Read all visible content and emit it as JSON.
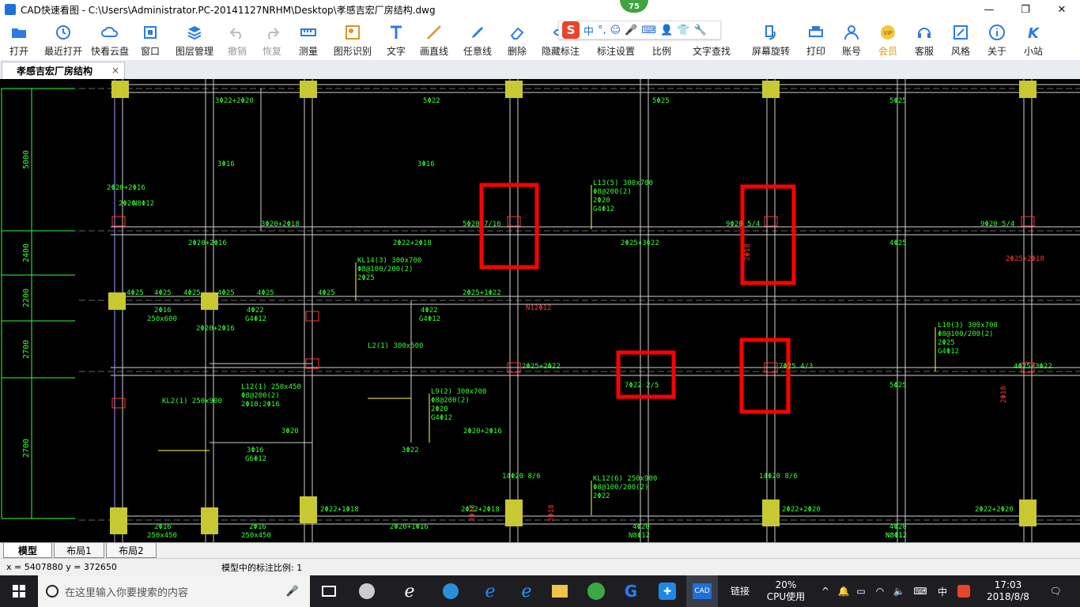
{
  "window": {
    "title": "CAD快速看图 - C:\\Users\\Administrator.PC-20141127NRHM\\Desktop\\孝感吉宏厂房结构.dwg",
    "badge": "75",
    "controls": {
      "minimize": "—",
      "maximize": "❐",
      "close": "✕"
    }
  },
  "toolbar": [
    {
      "id": "open",
      "label": "打开",
      "icon": "folder-icon"
    },
    {
      "id": "recent",
      "label": "最近打开",
      "icon": "history-icon"
    },
    {
      "id": "cloud",
      "label": "快看云盘",
      "icon": "cloud-icon"
    },
    {
      "id": "window",
      "label": "窗口",
      "icon": "window-icon"
    },
    {
      "id": "layers",
      "label": "图层管理",
      "icon": "layers-icon"
    },
    {
      "id": "undo",
      "label": "撤销",
      "icon": "undo-icon",
      "disabled": true
    },
    {
      "id": "redo",
      "label": "恢复",
      "icon": "redo-icon",
      "disabled": true
    },
    {
      "id": "measure",
      "label": "测量",
      "icon": "ruler-icon"
    },
    {
      "id": "recognize",
      "label": "图形识别",
      "icon": "shape-recognize-icon"
    },
    {
      "id": "text",
      "label": "文字",
      "icon": "text-icon"
    },
    {
      "id": "line",
      "label": "画直线",
      "icon": "line-icon"
    },
    {
      "id": "freeline",
      "label": "任意线",
      "icon": "pen-icon"
    },
    {
      "id": "delete",
      "label": "删除",
      "icon": "eraser-icon"
    },
    {
      "id": "hide",
      "label": "隐藏标注",
      "icon": "hide-icon"
    },
    {
      "id": "annotate",
      "label": "标注设置",
      "icon": "annotation-settings-icon"
    },
    {
      "id": "scale",
      "label": "比例",
      "icon": "scale-icon"
    },
    {
      "id": "findtext",
      "label": "文字查找",
      "icon": "text-search-icon"
    },
    {
      "id": "rotate",
      "label": "屏幕旋转",
      "icon": "rotate-screen-icon"
    },
    {
      "id": "print",
      "label": "打印",
      "icon": "printer-icon"
    },
    {
      "id": "account",
      "label": "账号",
      "icon": "user-icon"
    },
    {
      "id": "vip",
      "label": "会员",
      "icon": "vip-icon"
    },
    {
      "id": "service",
      "label": "客服",
      "icon": "headset-icon"
    },
    {
      "id": "style",
      "label": "风格",
      "icon": "style-icon"
    },
    {
      "id": "about",
      "label": "关于",
      "icon": "info-icon"
    },
    {
      "id": "site",
      "label": "小站",
      "icon": "k-logo-icon"
    }
  ],
  "ime": {
    "logo": "S",
    "mode": "中",
    "punct": "°,"
  },
  "document_tab": {
    "label": "孝感吉宏厂房结构",
    "close": "×"
  },
  "drawing": {
    "dims": [
      "5000",
      "2400",
      "2200",
      "2700",
      "2700"
    ],
    "labels": [
      "3Φ22+2Φ20",
      "5Φ22",
      "5Φ25",
      "5Φ25",
      "3Φ16",
      "3Φ16",
      "2Φ20+2Φ16",
      "2Φ20",
      "N8Φ12",
      "3Φ20+2Φ18",
      "5Φ20 7/16",
      "9Φ20 5/4",
      "9Φ20 5/4",
      "L13(5) 300x700",
      "Φ8@200(2)",
      "2Φ20",
      "G4Φ12",
      "2Φ20+2Φ16",
      "2Φ22+2Φ18",
      "2Φ25+3Φ22",
      "4Φ25",
      "KL14(3) 300x700",
      "Φ8@100/200(2)",
      "2Φ25",
      "4Φ25",
      "4Φ25",
      "4Φ25",
      "4Φ25",
      "4Φ25",
      "4Φ25",
      "2Φ25+1Φ22",
      "2Φ16",
      "250x600",
      "4Φ22",
      "G4Φ12",
      "4Φ22",
      "G4Φ12",
      "N12Φ12",
      "L10(3) 300x700",
      "Φ8@100/200(2)",
      "2Φ25",
      "G4Φ12",
      "2Φ25+2Φ22",
      "7Φ22 2/5",
      "7Φ25 4/3",
      "4Φ25/3Φ22",
      "5Φ25",
      "L12(1) 250x450",
      "Φ8@200(2)",
      "2Φ18;2Φ16",
      "L2(1) 300x500",
      "L9(2) 300x700",
      "Φ8@200(2)",
      "2Φ20",
      "G4Φ12",
      "KL2(1) 250x900",
      "3Φ20",
      "2Φ20+2Φ16",
      "3Φ16",
      "G6Φ12",
      "3Φ22",
      "KL12(6) 250x900",
      "Φ8@100/200(2)",
      "2Φ22",
      "2Φ22+1Φ18",
      "2Φ22+2Φ18",
      "2Φ22+2Φ20",
      "2Φ22+2Φ20",
      "2Φ16",
      "250x450",
      "2Φ16",
      "250x450",
      "2Φ20+1Φ16",
      "N8Φ12",
      "4Φ20",
      "N8Φ12",
      "4Φ20",
      "N8Φ12",
      "14Φ20 8/6",
      "14Φ20 8/6",
      "2Φ20+2Φ16",
      "2Φ25+2Φ18",
      "2Φ18",
      "2Φ18",
      "2Φ18",
      "2Φ18"
    ]
  },
  "layout_tabs": [
    "模型",
    "布局1",
    "布局2"
  ],
  "status": {
    "coords": "x = 5407880  y = 372650",
    "scale": "模型中的标注比例: 1"
  },
  "taskbar": {
    "search_placeholder": "在这里输入你要搜索的内容",
    "link": "链接",
    "cpu_percent": "20%",
    "cpu_label": "CPU使用",
    "ime": "中",
    "time": "17:03",
    "date": "2018/8/8"
  },
  "colors": {
    "red_box": "#ff0000",
    "column": "#c8c832",
    "rebar_text": "#33ff33",
    "red_text": "#ff3333"
  }
}
